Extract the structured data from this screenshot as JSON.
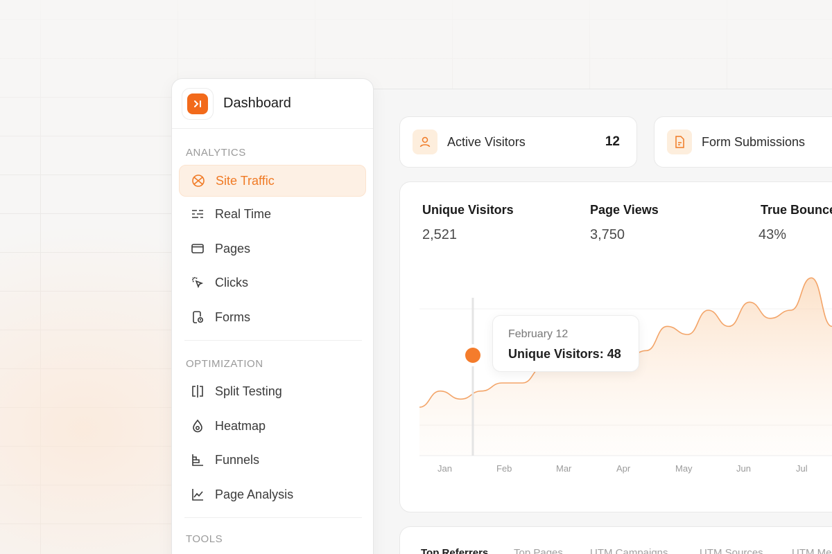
{
  "sidebar": {
    "title": "Dashboard",
    "sections": {
      "analytics": "ANALYTICS",
      "optimization": "OPTIMIZATION",
      "tools": "TOOLS"
    },
    "items": [
      {
        "label": "Site Traffic",
        "icon": "globe-icon",
        "active": true
      },
      {
        "label": "Real Time",
        "icon": "list-lines-icon"
      },
      {
        "label": "Pages",
        "icon": "window-icon"
      },
      {
        "label": "Clicks",
        "icon": "cursor-click-icon"
      },
      {
        "label": "Forms",
        "icon": "form-icon"
      },
      {
        "label": "Split Testing",
        "icon": "split-icon"
      },
      {
        "label": "Heatmap",
        "icon": "flame-icon"
      },
      {
        "label": "Funnels",
        "icon": "funnel-bars-icon"
      },
      {
        "label": "Page Analysis",
        "icon": "line-chart-icon"
      }
    ]
  },
  "stats": [
    {
      "label": "Active Visitors",
      "value": "12",
      "icon": "user-icon"
    },
    {
      "label": "Form Submissions",
      "value": "",
      "icon": "document-icon"
    }
  ],
  "metrics": [
    {
      "label": "Unique Visitors",
      "value": "2,521"
    },
    {
      "label": "Page Views",
      "value": "3,750"
    },
    {
      "label": "True Bounce",
      "value": "43%"
    }
  ],
  "tooltip": {
    "date": "February 12",
    "text": "Unique Visitors: 48"
  },
  "tabs": [
    "Top Referrers",
    "Top Pages",
    "UTM Campaigns",
    "UTM Sources",
    "UTM Me"
  ],
  "colors": {
    "accent": "#f26a1b",
    "accent_light": "#fdf0e4"
  },
  "chart_data": {
    "type": "area",
    "x": [
      "Jan",
      "Feb",
      "Mar",
      "Apr",
      "May",
      "Jun",
      "Jul"
    ],
    "series": [
      {
        "name": "Unique Visitors",
        "values": [
          46,
          48,
          47,
          48,
          49,
          49,
          51,
          51,
          52,
          54,
          52,
          53,
          56,
          55,
          58,
          56,
          59,
          57,
          58,
          62,
          56
        ]
      }
    ],
    "highlight": {
      "x": "February 12",
      "value": 48
    },
    "grid": true
  }
}
